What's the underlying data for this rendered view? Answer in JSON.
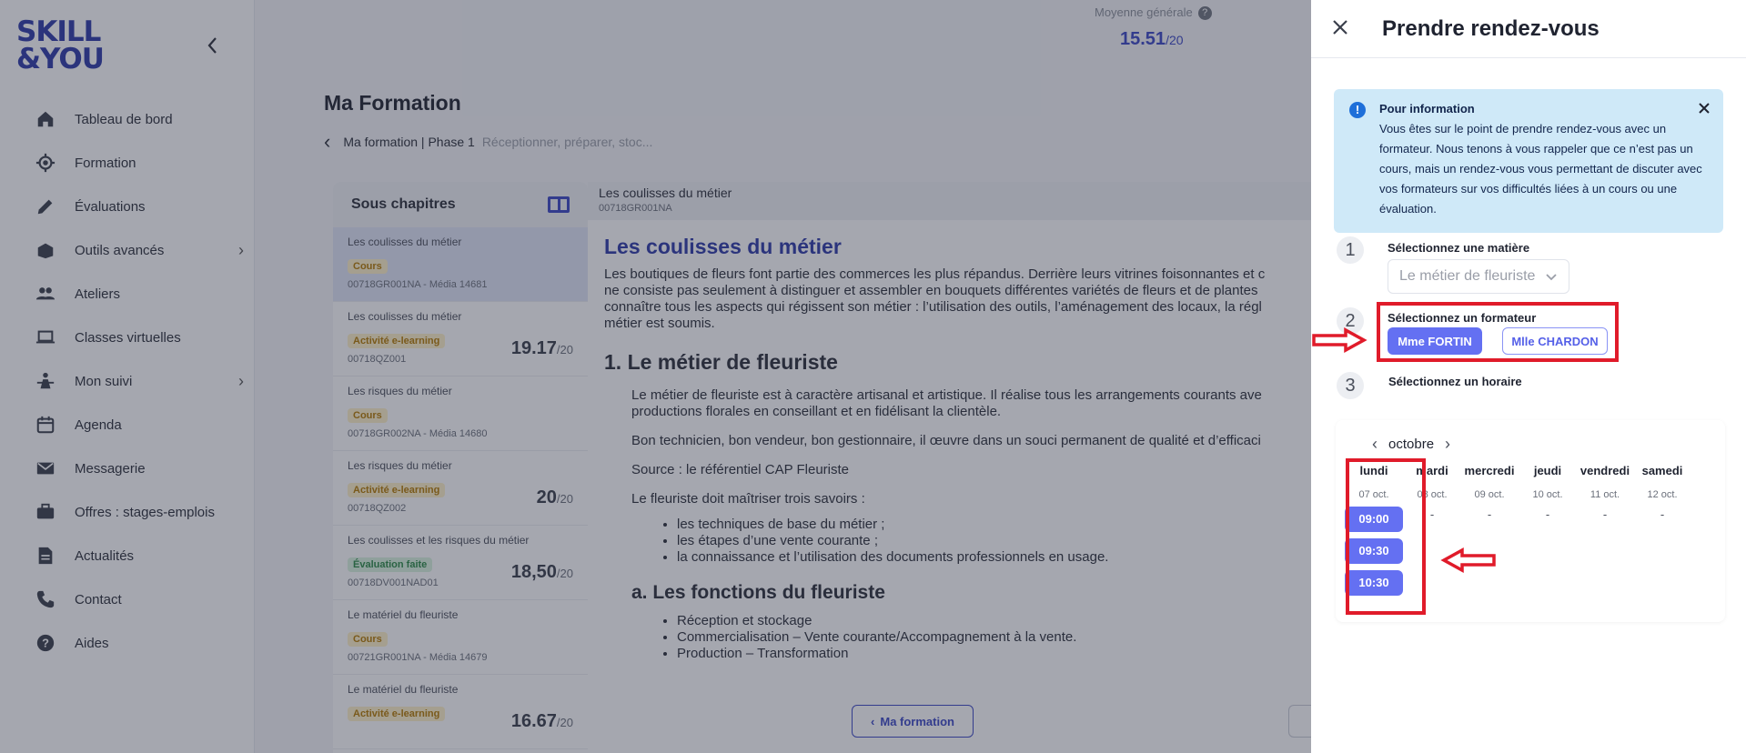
{
  "sidebar": {
    "logo_line1": "SKILL",
    "logo_line2": "&YOU",
    "collapse_icon": "chevron-left-icon",
    "items": [
      {
        "label": "Tableau de bord",
        "icon": "home-icon"
      },
      {
        "label": "Formation",
        "icon": "target-icon"
      },
      {
        "label": "Évaluations",
        "icon": "pencil-icon"
      },
      {
        "label": "Outils avancés",
        "icon": "toolbox-icon",
        "has_children": true
      },
      {
        "label": "Ateliers",
        "icon": "people-icon"
      },
      {
        "label": "Classes virtuelles",
        "icon": "laptop-icon"
      },
      {
        "label": "Mon suivi",
        "icon": "person-chart-icon",
        "has_children": true
      },
      {
        "label": "Agenda",
        "icon": "calendar-icon"
      },
      {
        "label": "Messagerie",
        "icon": "mail-icon"
      },
      {
        "label": "Offres : stages-emplois",
        "icon": "briefcase-icon"
      },
      {
        "label": "Actualités",
        "icon": "news-icon"
      },
      {
        "label": "Contact",
        "icon": "phone-icon"
      },
      {
        "label": "Aides",
        "icon": "help-icon"
      }
    ]
  },
  "header": {
    "average_label": "Moyenne générale",
    "average_value": "15.51",
    "average_max": "/20",
    "page_title": "Ma Formation",
    "breadcrumb_current": "Ma formation | Phase 1",
    "breadcrumb_muted": "Réceptionner, préparer, stoc..."
  },
  "chapters": {
    "heading": "Sous chapitres",
    "items": [
      {
        "title": "Les coulisses du métier",
        "badge": "Cours",
        "badge_type": "cours",
        "code": "00718GR001NA - Média 14681",
        "score": "",
        "max": "",
        "active": true
      },
      {
        "title": "Les coulisses du métier",
        "badge": "Activité e-learning",
        "badge_type": "elearn",
        "code": "00718QZ001",
        "score": "19.17",
        "max": "/20"
      },
      {
        "title": "Les risques du métier",
        "badge": "Cours",
        "badge_type": "cours",
        "code": "00718GR002NA - Média 14680",
        "score": "",
        "max": ""
      },
      {
        "title": "Les risques du métier",
        "badge": "Activité e-learning",
        "badge_type": "elearn",
        "code": "00718QZ002",
        "score": "20",
        "max": "/20"
      },
      {
        "title": "Les coulisses et les risques du métier",
        "badge": "Évaluation faite",
        "badge_type": "eval",
        "code": "00718DV001NAD01",
        "score": "18,50",
        "max": "/20"
      },
      {
        "title": "Le matériel du fleuriste",
        "badge": "Cours",
        "badge_type": "cours",
        "code": "00721GR001NA - Média 14679",
        "score": "",
        "max": ""
      },
      {
        "title": "Le matériel du fleuriste",
        "badge": "Activité e-learning",
        "badge_type": "elearn",
        "code": "",
        "score": "16.67",
        "max": "/20"
      }
    ]
  },
  "content": {
    "head_title": "Les coulisses du métier",
    "head_code": "00718GR001NA",
    "h1": "Les coulisses du métier",
    "lead": "Les boutiques de fleurs font partie des commerces les plus répandus. Derrière leurs vitrines foisonnantes et c\nne consiste pas seulement à distinguer et assembler en bouquets différentes variétés de fleurs et de plantes\nconnaître tous les aspects qui régissent son métier : l’utilisation des outils, l’aménagement des locaux, la régl\nmétier est soumis.",
    "h2": "1. Le métier de fleuriste",
    "p1": "Le métier de fleuriste est à caractère artisanal et artistique. Il réalise tous les arrangements courants ave\nproductions florales en conseillant et en fidélisant la clientèle.",
    "p2": "Bon technicien, bon vendeur, bon gestionnaire, il œuvre dans un souci permanent de qualité et d’efficaci",
    "p3": "Source : le référentiel CAP Fleuriste",
    "p4": "Le fleuriste doit maîtriser trois savoirs :",
    "list1": [
      "les techniques de base du métier ;",
      "les étapes d’une vente courante ;",
      "la connaissance et l’utilisation des documents professionnels en usage."
    ],
    "h3": "a. Les fonctions du fleuriste",
    "list2": [
      "Réception et stockage",
      "Commercialisation – Vente courante/Accompagnement à la vente.",
      "Production – Transformation"
    ],
    "back_button": "Ma formation"
  },
  "drawer": {
    "title": "Prendre rendez-vous",
    "info_title": "Pour information",
    "info_text": "Vous êtes sur le point de prendre rendez-vous avec un formateur. Nous tenons à vous rappeler que ce n’est pas un cours, mais un rendez-vous vous permettant de discuter avec vos formateurs sur vos difficultés liées à un cours ou une évaluation.",
    "step1_num": "1",
    "step1_label": "Sélectionnez une matière",
    "subject_value": "Le métier de fleuriste",
    "step2_num": "2",
    "step2_label": "Sélectionnez un formateur",
    "trainers": [
      {
        "name": "Mme FORTIN",
        "selected": true
      },
      {
        "name": "Mlle CHARDON",
        "selected": false
      }
    ],
    "step3_num": "3",
    "step3_label": "Sélectionnez un horaire",
    "month": "octobre",
    "days": [
      {
        "name": "lundi",
        "date": "07 oct.",
        "slots": [
          "09:00",
          "09:30",
          "10:30"
        ]
      },
      {
        "name": "mardi",
        "date": "08 oct.",
        "slots": [],
        "empty": "-"
      },
      {
        "name": "mercredi",
        "date": "09 oct.",
        "slots": [],
        "empty": "-"
      },
      {
        "name": "jeudi",
        "date": "10 oct.",
        "slots": [],
        "empty": "-"
      },
      {
        "name": "vendredi",
        "date": "11 oct.",
        "slots": [],
        "empty": "-"
      },
      {
        "name": "samedi",
        "date": "12 oct.",
        "slots": [],
        "empty": "-"
      }
    ]
  },
  "colors": {
    "accent": "#6470f2",
    "brand": "#2d3aa8",
    "annotation_red": "#e01b2a",
    "info_bg": "#cfe9f8"
  }
}
